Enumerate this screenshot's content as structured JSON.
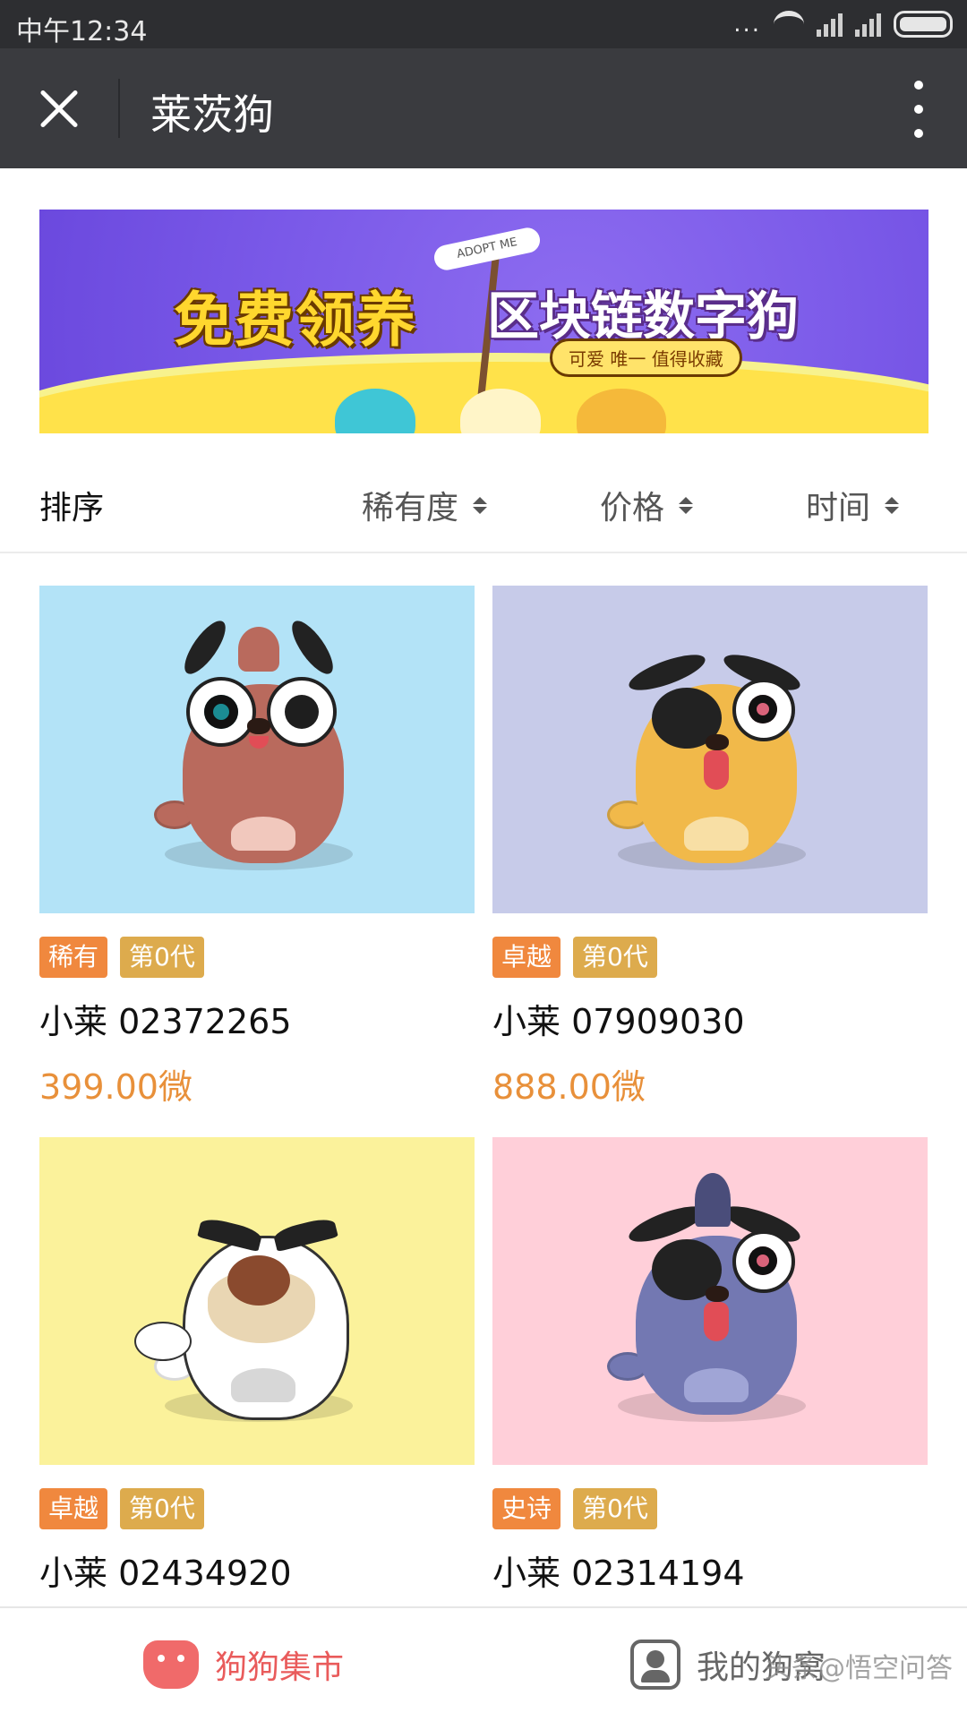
{
  "status": {
    "time": "中午12:34",
    "dots": "..."
  },
  "header": {
    "title": "莱茨狗"
  },
  "banner": {
    "headline": "免费领养",
    "subhead": "区块链数字狗",
    "tagline": "可爱  唯一  值得收藏",
    "sign": "ADOPT ME",
    "bg_color": "#7a59e8",
    "wave_color": "#ffe24a"
  },
  "sort": {
    "label": "排序",
    "options": [
      {
        "label": "稀有度"
      },
      {
        "label": "价格"
      },
      {
        "label": "时间"
      }
    ]
  },
  "dogs": [
    {
      "rarity": "稀有",
      "generation": "第0代",
      "name": "小莱 02372265",
      "price": "399.00微",
      "bg": "#b3e3f7",
      "body_color": "#b96a5d",
      "belly_color": "#f1c8bd",
      "style": "fluffy"
    },
    {
      "rarity": "卓越",
      "generation": "第0代",
      "name": "小莱 07909030",
      "price": "888.00微",
      "bg": "#c7cbe9",
      "body_color": "#f1b94a",
      "belly_color": "#f8dfa5",
      "style": "eyepatch"
    },
    {
      "rarity": "卓越",
      "generation": "第0代",
      "name": "小莱 02434920",
      "price": "",
      "bg": "#fbf29b",
      "body_color": "#ffffff",
      "belly_color": "#d7d7d7",
      "style": "grumpy"
    },
    {
      "rarity": "史诗",
      "generation": "第0代",
      "name": "小莱 02314194",
      "price": "",
      "bg": "#ffcfd9",
      "body_color": "#7378b2",
      "belly_color": "#a0a5d6",
      "style": "eyepatch"
    }
  ],
  "bottom_nav": {
    "market": "狗狗集市",
    "mine": "我的狗窝"
  },
  "watermark": "头条@悟空问答",
  "colors": {
    "accent_price": "#e8903a",
    "tag_rarity": "#f0883e",
    "tag_gen": "#ddab4d",
    "nav_active": "#e95b5b"
  }
}
